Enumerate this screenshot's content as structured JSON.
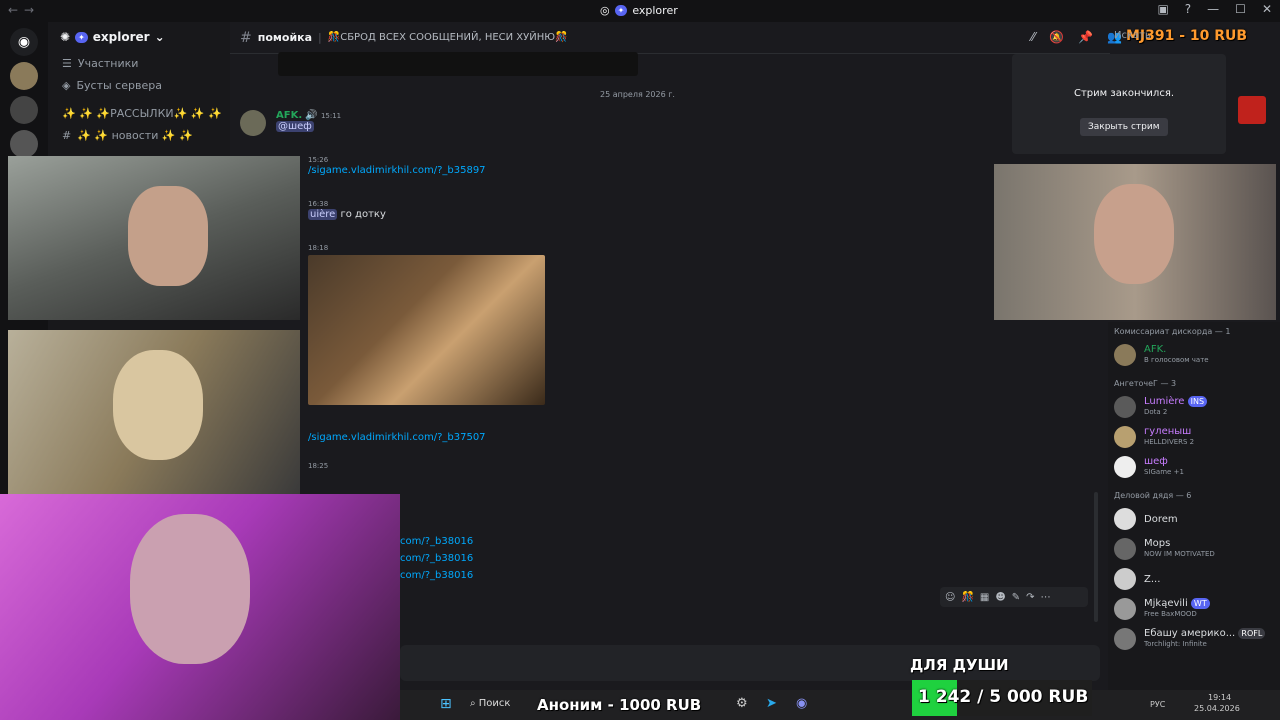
{
  "window": {
    "title": "explorer",
    "title_badge": "✦"
  },
  "guild": {
    "name": "explorer",
    "badge": "✦"
  },
  "channels": [
    {
      "icon": "people-icon",
      "label": "Участники"
    },
    {
      "icon": "boost-icon",
      "label": "Бусты сервера"
    },
    {
      "icon": "hash-icon",
      "label": "✨ ✨ ✨РАССЫЛКИ✨ ✨ ✨"
    },
    {
      "icon": "hash-icon",
      "label": "✨ ✨ новости ✨ ✨"
    }
  ],
  "header": {
    "channel": "помойка",
    "topic": "🎊СБРОД ВСЕХ СООБЩЕНИЙ, НЕСИ ХУЙНЮ🎊",
    "donate_overlay": "MJ391 - 10 RUB",
    "search_placeholder": "Искать"
  },
  "date_divider": "25 апреля 2026 г.",
  "messages": [
    {
      "author": "AFK.",
      "time": "15:11",
      "mention": "@шеф"
    },
    {
      "time": "15:26",
      "link": "/sigame.vladimirkhil.com/?_b35897"
    },
    {
      "time": "16:38",
      "mention": "uière",
      "text": "го дотку"
    },
    {
      "time": "18:18"
    },
    {
      "link": "/sigame.vladimirkhil.com/?_b37507"
    },
    {
      "time": "18:25"
    },
    {
      "link": "com/?_b38016"
    },
    {
      "link": "com/?_b38016"
    },
    {
      "link": "com/?_b38016"
    }
  ],
  "stream_ended": {
    "text": "Стрим закончился.",
    "button": "Закрыть стрим"
  },
  "members": {
    "groups": [
      {
        "title": "Комиссариат дискорда — 1",
        "items": [
          {
            "name": "AFK.",
            "status": "В голосовом чате",
            "color": "#23a55a"
          }
        ]
      },
      {
        "title": "АнгеточеГ — 3",
        "items": [
          {
            "name": "Lumière",
            "tag": "INS",
            "status": "Dota 2",
            "color": "#c77dff"
          },
          {
            "name": "гуленыш",
            "status": "HELLDIVERS 2",
            "color": "#c77dff"
          },
          {
            "name": "шеф",
            "status": "SIGame +1",
            "color": "#c77dff"
          }
        ]
      },
      {
        "title": "Деловой дядя — 6",
        "items": [
          {
            "name": "Dorem",
            "status": "",
            "color": "#dbdee1"
          },
          {
            "name": "Mops",
            "status": "NOW IM MOTIVATED",
            "color": "#dbdee1"
          },
          {
            "name": "Z...",
            "status": "",
            "color": "#dbdee1"
          },
          {
            "name": "Mjkąevili",
            "tag": "WT",
            "status": "Free BaxMOOD",
            "color": "#dbdee1"
          },
          {
            "name": "Ебашу америко...",
            "tag": "ROFL",
            "status": "Torchlight: Infinite",
            "color": "#dbdee1"
          }
        ]
      }
    ]
  },
  "overlays": {
    "for_soul": "ДЛЯ ДУШИ",
    "goal_text": "1 242 / 5 000 RUB",
    "goal_fraction": 0.248,
    "anon_donation": "Аноним - 1000 RUB"
  },
  "taskbar": {
    "search": "Поиск",
    "lang": "РУС",
    "time": "19:14",
    "date": "25.04.2026"
  },
  "colors": {
    "green": "#23a55a",
    "link": "#00a8fc",
    "accent": "#5865f2"
  }
}
